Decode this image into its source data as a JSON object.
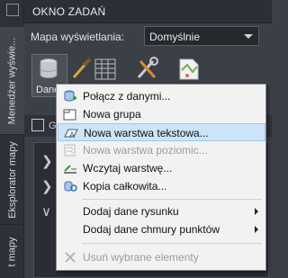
{
  "header": {
    "title": "OKNO ZADAŃ"
  },
  "vertical_tabs": [
    {
      "label": "Menedżer wyświe..."
    },
    {
      "label": "Eksplorator mapy"
    },
    {
      "label": "t mapy"
    }
  ],
  "map_view": {
    "label": "Mapa wyświetlania:",
    "value": "Domyślnie"
  },
  "toolbar": {
    "data_button_label": "Dane"
  },
  "subbar": {
    "label": "G"
  },
  "context_menu": {
    "items": [
      {
        "label": "Połącz z danymi...",
        "icon": "connect-data-icon",
        "enabled": true,
        "selected": false
      },
      {
        "label": "Nowa grupa",
        "icon": "folder-icon",
        "enabled": true,
        "selected": false
      },
      {
        "label": "Nowa warstwa tekstowa...",
        "icon": "text-layer-icon",
        "enabled": true,
        "selected": true
      },
      {
        "label": "Nowa warstwa poziomic...",
        "icon": "contour-layer-icon",
        "enabled": false,
        "selected": false
      },
      {
        "label": "Wczytaj warstwę...",
        "icon": "load-layer-icon",
        "enabled": true,
        "selected": false
      },
      {
        "label": "Kopia całkowita...",
        "icon": "full-copy-icon",
        "enabled": true,
        "selected": false
      },
      {
        "label": "Dodaj dane rysunku",
        "icon": "",
        "enabled": true,
        "selected": false,
        "submenu": true
      },
      {
        "label": "Dodaj dane chmury punktów",
        "icon": "",
        "enabled": true,
        "selected": false,
        "submenu": true
      },
      {
        "label": "Usuń wybrane elementy",
        "icon": "delete-icon",
        "enabled": false,
        "selected": false
      }
    ]
  },
  "colors": {
    "panel_bg": "#3b3f46",
    "menu_bg": "#f2f2f2",
    "menu_selected": "#cce4f7",
    "disabled_text": "#9b9b9b"
  }
}
